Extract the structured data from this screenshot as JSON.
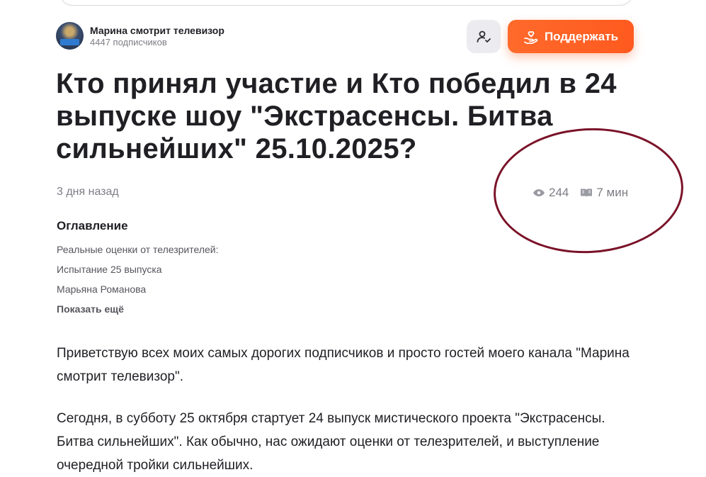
{
  "channel": {
    "name": "Марина смотрит телевизор",
    "subscribers": "4447 подписчиков"
  },
  "actions": {
    "subscribe_icon": "person-check-icon",
    "support_label": "Поддержать",
    "support_icon": "hand-heart-icon",
    "support_color": "#ff5f25"
  },
  "article": {
    "title": "Кто принял участие и Кто победил в 24 выпуске шоу \"Экстрасенсы. Битва сильнейших\" 25.10.2025?",
    "date": "3 дня назад",
    "views": "244",
    "read_time": "7 мин",
    "paragraphs": [
      "Приветствую всех моих самых дорогих подписчиков и просто гостей моего канала \"Марина смотрит телевизор\".",
      "Сегодня, в субботу 25 октября стартует 24 выпуск мистического проекта \"Экстрасенсы. Битва сильнейших\". Как обычно, нас ожидают оценки от телезрителей, и выступление очередной тройки сильнейших."
    ]
  },
  "toc": {
    "title": "Оглавление",
    "items": [
      "Реальные оценки от телезрителей:",
      "Испытание 25 выпуска",
      "Марьяна Романова"
    ],
    "show_more": "Показать ещё"
  },
  "annotation": {
    "shape": "hand-drawn-oval",
    "color": "#7a1228"
  }
}
